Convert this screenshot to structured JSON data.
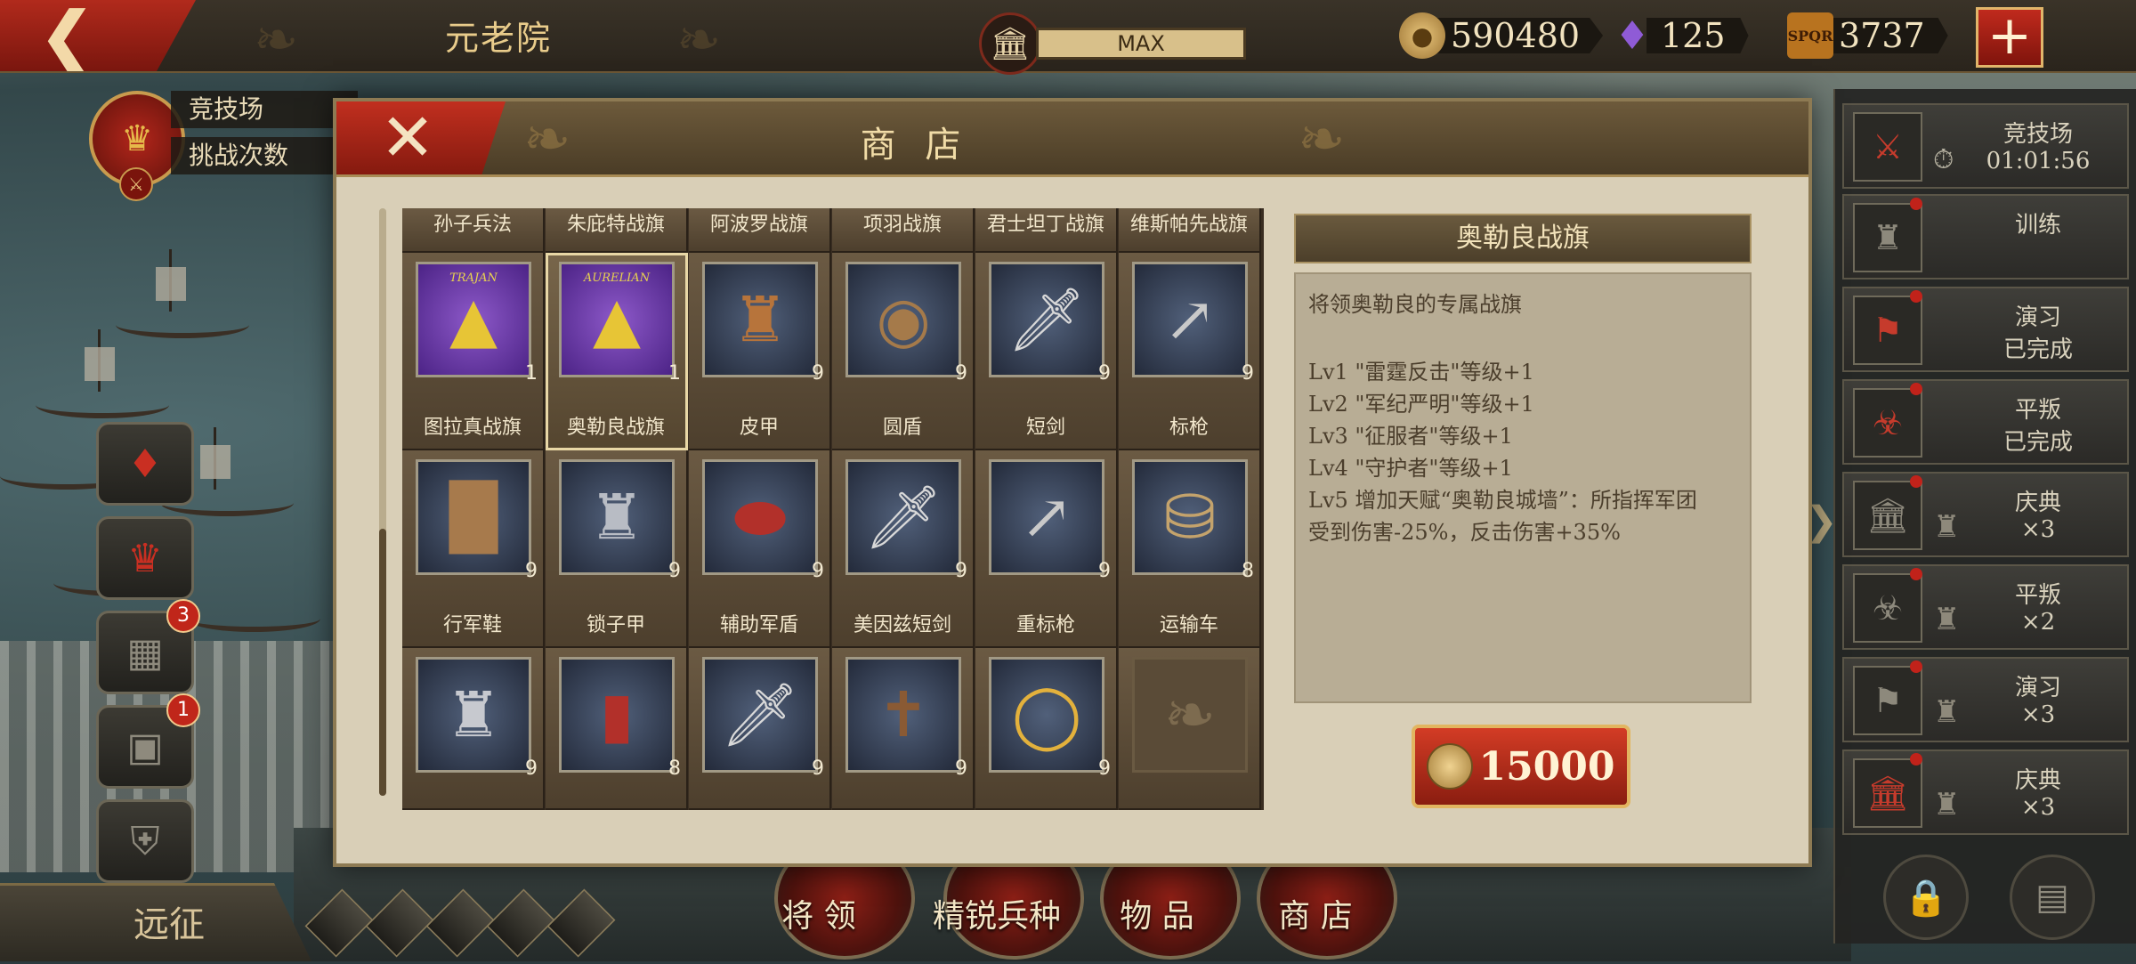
{
  "top_bar": {
    "title": "元老院",
    "building_level": "MAX",
    "coins": "590480",
    "gems": "125",
    "spqr": "3737",
    "spqr_icon_text": "SPQR",
    "plus": "+"
  },
  "left_sidebar": {
    "arena_label": "竞技场",
    "challenge_label": "挑战次数",
    "buttons": [
      {
        "icon": "reward-bag-icon",
        "badge": ""
      },
      {
        "icon": "crown-icon",
        "badge": ""
      },
      {
        "icon": "film-icon",
        "badge": "3"
      },
      {
        "icon": "chest-icon",
        "badge": "1"
      },
      {
        "icon": "trophy-icon",
        "badge": ""
      }
    ],
    "expedition_label": "远征"
  },
  "bottom_tabs": [
    {
      "label": "将 领"
    },
    {
      "label": "精锐兵种"
    },
    {
      "label": "物 品"
    },
    {
      "label": "商 店"
    }
  ],
  "right_panel": {
    "items": [
      {
        "title": "竞技场",
        "sub": "01:01:56",
        "icon": "crossed-swords-icon"
      },
      {
        "title": "训练",
        "sub": "",
        "icon": "helmet-icon"
      },
      {
        "title": "演习",
        "sub": "已完成",
        "icon": "banner-icon"
      },
      {
        "title": "平叛",
        "sub": "已完成",
        "icon": "mask-icon"
      },
      {
        "title": "庆典",
        "sub": "×3",
        "icon": "temple-icon"
      },
      {
        "title": "平叛",
        "sub": "×2",
        "icon": "mask-icon"
      },
      {
        "title": "演习",
        "sub": "×3",
        "icon": "banner-icon"
      },
      {
        "title": "庆典",
        "sub": "×3",
        "icon": "temple-icon"
      }
    ]
  },
  "shop": {
    "title": "商 店",
    "top_row_labels": [
      "孙子兵法",
      "朱庇特战旗",
      "阿波罗战旗",
      "项羽战旗",
      "君士坦丁战旗",
      "维斯帕先战旗"
    ],
    "items": [
      {
        "name": "图拉真战旗",
        "count": "1",
        "icon": "banner-icon",
        "banner_text": "TRAJAN"
      },
      {
        "name": "奥勒良战旗",
        "count": "1",
        "icon": "banner-icon",
        "banner_text": "AURELIAN",
        "selected": true
      },
      {
        "name": "皮甲",
        "count": "9",
        "icon": "leather-armor-icon"
      },
      {
        "name": "圆盾",
        "count": "9",
        "icon": "round-shield-icon"
      },
      {
        "name": "短剑",
        "count": "9",
        "icon": "short-sword-icon"
      },
      {
        "name": "标枪",
        "count": "9",
        "icon": "javelin-icon"
      },
      {
        "name": "行军鞋",
        "count": "9",
        "icon": "boots-icon"
      },
      {
        "name": "锁子甲",
        "count": "9",
        "icon": "chainmail-icon"
      },
      {
        "name": "辅助军盾",
        "count": "9",
        "icon": "oval-shield-icon"
      },
      {
        "name": "美因兹短剑",
        "count": "9",
        "icon": "gladius-icon"
      },
      {
        "name": "重标枪",
        "count": "9",
        "icon": "pilum-icon"
      },
      {
        "name": "运输车",
        "count": "8",
        "icon": "supply-cart-icon"
      },
      {
        "name": "",
        "count": "9",
        "icon": "mail-shirt-icon"
      },
      {
        "name": "",
        "count": "8",
        "icon": "scutum-icon"
      },
      {
        "name": "",
        "count": "9",
        "icon": "sword-icon"
      },
      {
        "name": "",
        "count": "9",
        "icon": "crossbow-icon"
      },
      {
        "name": "",
        "count": "9",
        "icon": "ring-icon"
      },
      {
        "name": "",
        "count": "",
        "icon": "empty-slot-icon"
      }
    ],
    "detail": {
      "title": "奥勒良战旗",
      "description": "将领奥勒良的专属战旗",
      "levels": [
        "Lv1  \"雷霆反击\"等级+1",
        "Lv2  \"军纪严明\"等级+1",
        "Lv3  \"征服者\"等级+1",
        "Lv4  \"守护者\"等级+1",
        "Lv5  增加天赋“奥勒良城墙”：所指挥军团",
        "受到伤害-25%，反击伤害+35%"
      ],
      "price": "15000"
    }
  }
}
